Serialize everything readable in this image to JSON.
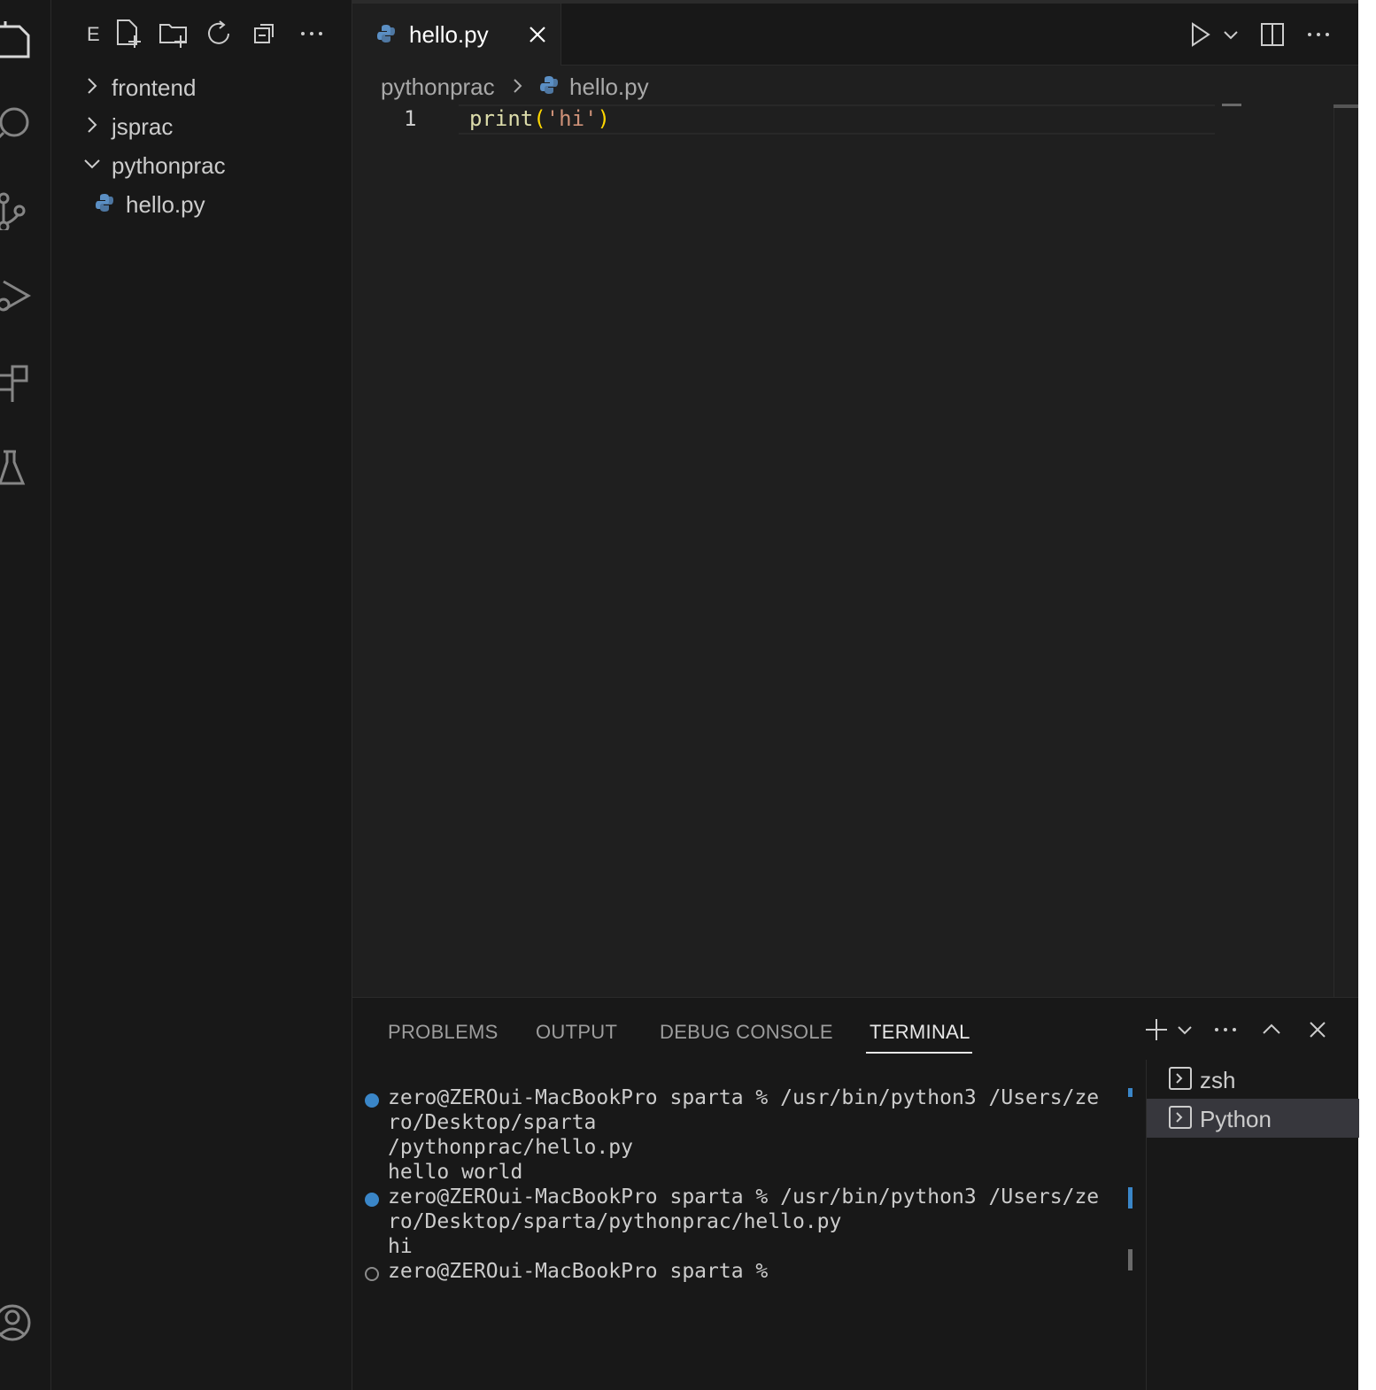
{
  "activity_bar": {
    "icons": [
      "explorer-icon",
      "search-icon",
      "source-control-icon",
      "run-debug-icon",
      "extensions-icon",
      "testing-icon",
      "account-icon"
    ]
  },
  "sidebar": {
    "title": "E",
    "actions": [
      "new-file-icon",
      "new-folder-icon",
      "refresh-icon",
      "collapse-all-icon",
      "more-icon"
    ],
    "tree": [
      {
        "label": "frontend",
        "expanded": false,
        "type": "folder"
      },
      {
        "label": "jsprac",
        "expanded": false,
        "type": "folder"
      },
      {
        "label": "pythonprac",
        "expanded": true,
        "type": "folder"
      },
      {
        "label": "hello.py",
        "type": "file"
      }
    ]
  },
  "editor": {
    "tab": {
      "label": "hello.py"
    },
    "actions": [
      "run-icon",
      "chevron-down-icon",
      "split-editor-icon",
      "more-icon"
    ],
    "breadcrumb": {
      "folder": "pythonprac",
      "file": "hello.py"
    },
    "line_number": "1",
    "code": {
      "fn": "print",
      "open": "(",
      "str": "'hi'",
      "close": ")"
    }
  },
  "panel": {
    "tabs": [
      "PROBLEMS",
      "OUTPUT",
      "DEBUG CONSOLE",
      "TERMINAL"
    ],
    "active_tab": "TERMINAL",
    "terminal_lines": [
      "zero@ZEROui-MacBookPro sparta % /usr/bin/python3 /Users/ze",
      "ro/Desktop/sparta",
      "/pythonprac/hello.py",
      "hello world",
      "zero@ZEROui-MacBookPro sparta % /usr/bin/python3 /Users/ze",
      "ro/Desktop/sparta/pythonprac/hello.py",
      "hi",
      "zero@ZEROui-MacBookPro sparta %"
    ],
    "terminals": [
      {
        "label": "zsh",
        "active": false
      },
      {
        "label": "Python",
        "active": true
      }
    ]
  },
  "colors": {
    "accent": "#3a86c8",
    "python_blue": "#4a7fb5",
    "background": "#1f1f1f"
  }
}
